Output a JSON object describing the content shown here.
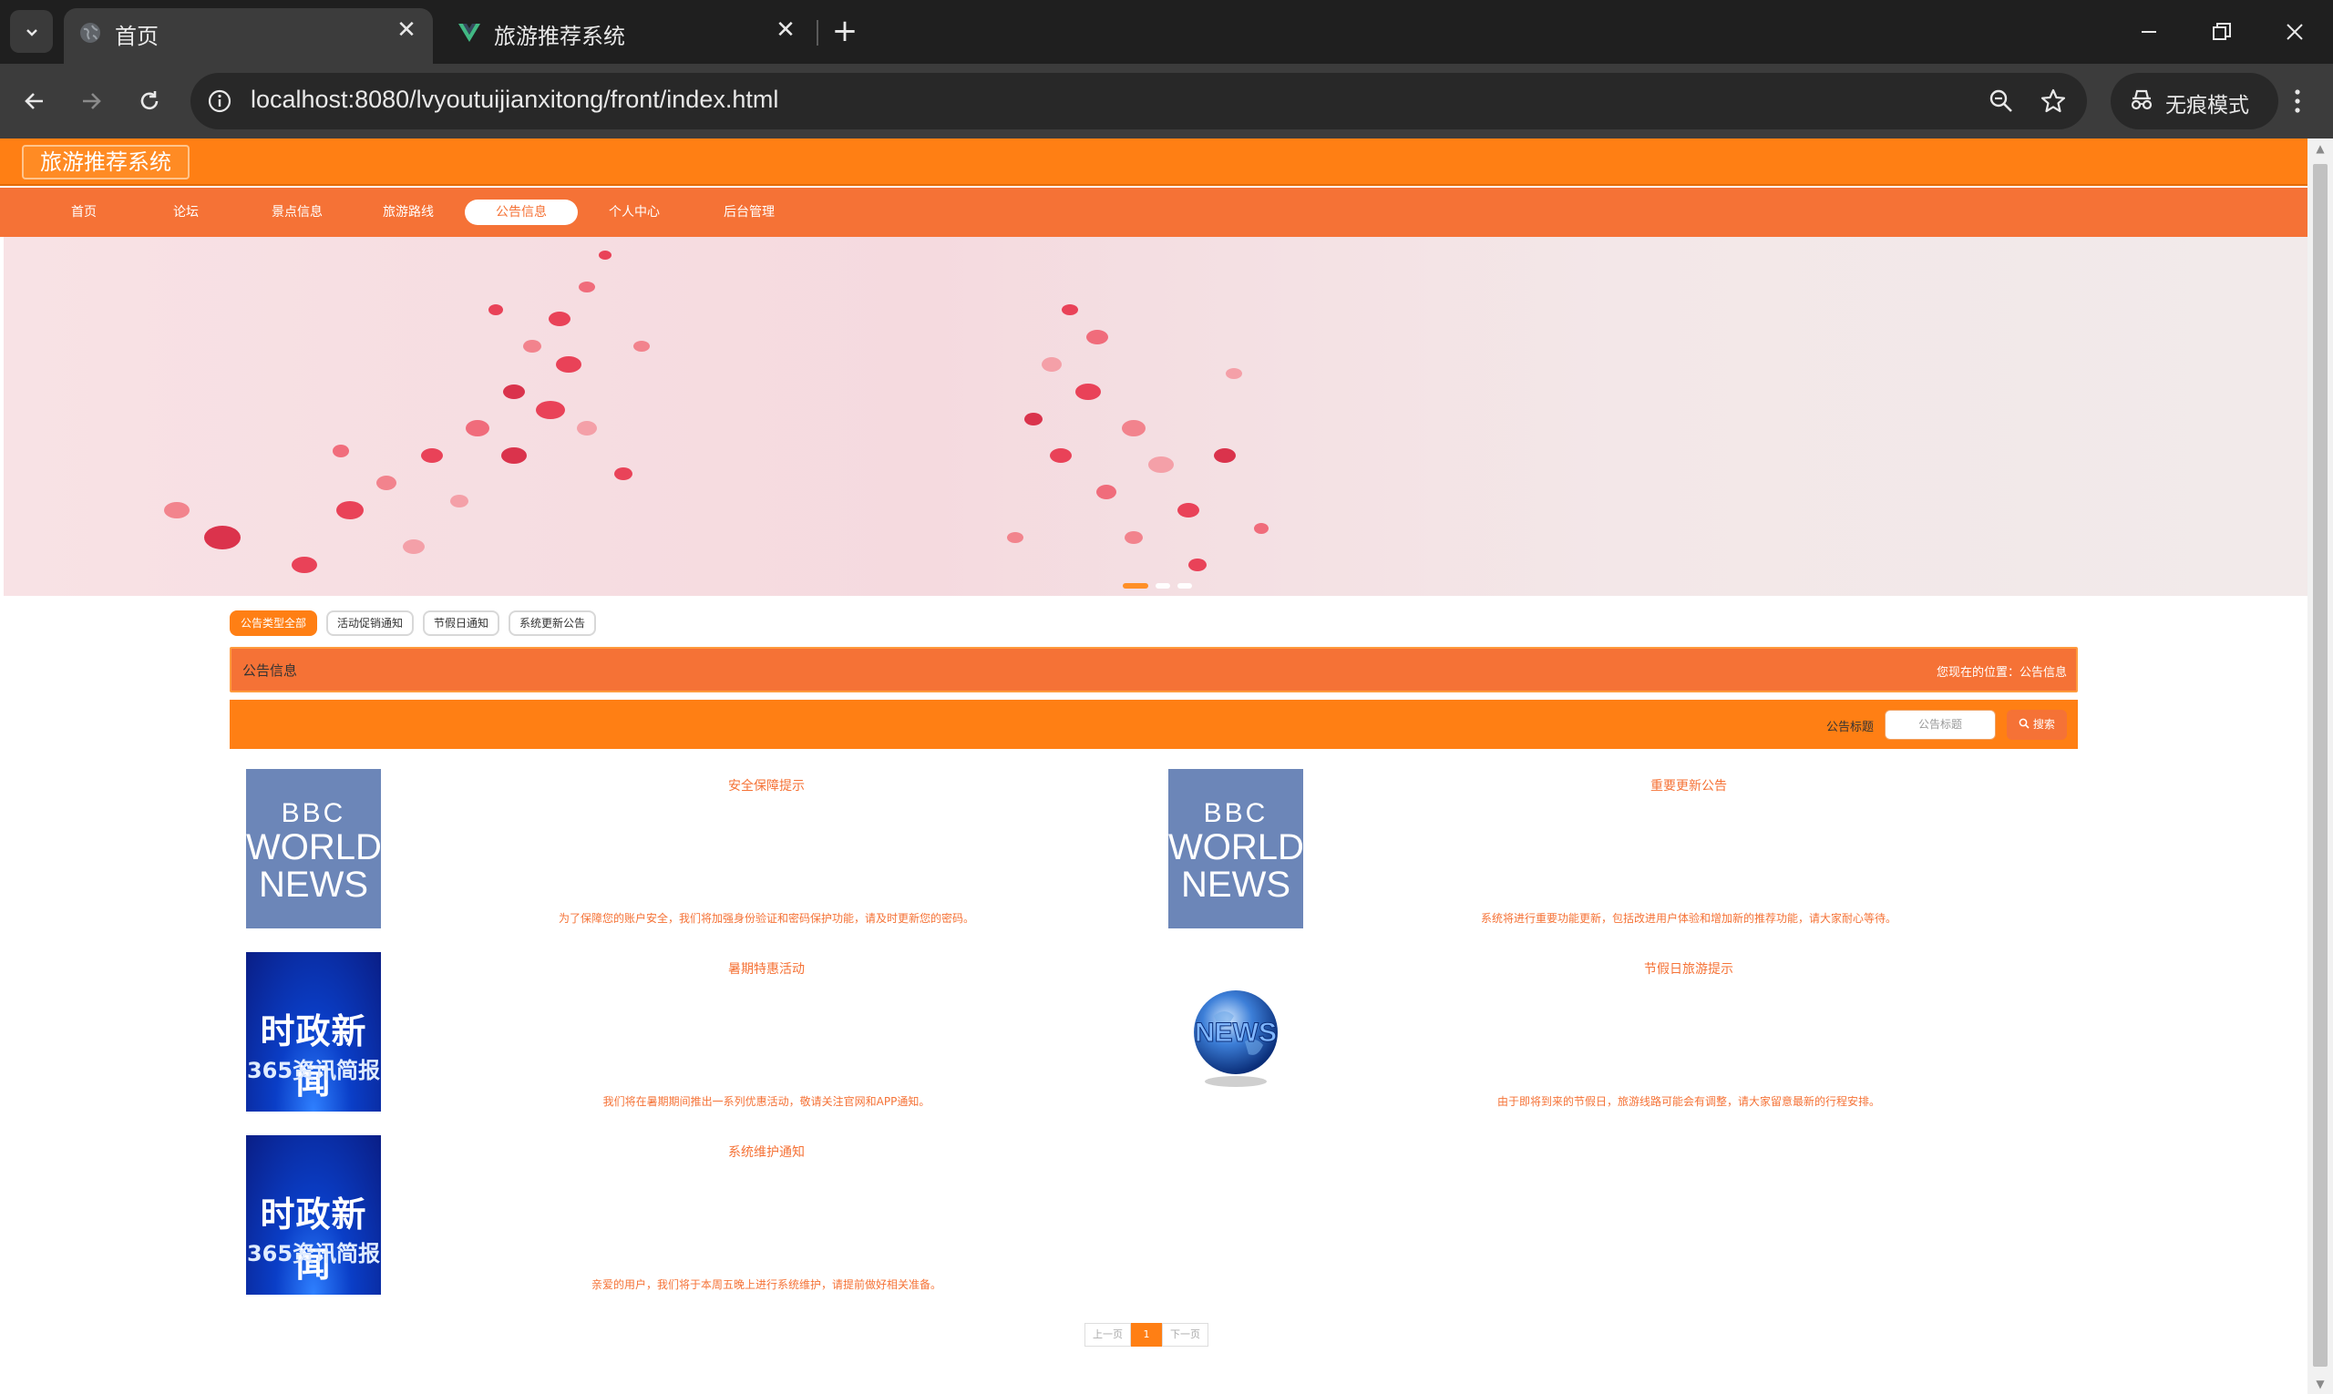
{
  "browser": {
    "tabs": [
      {
        "title": "首页",
        "active": true
      },
      {
        "title": "旅游推荐系统",
        "active": false
      }
    ],
    "url": "localhost:8080/lvyoutuijianxitong/front/index.html",
    "incognito_label": "无痕模式"
  },
  "site": {
    "logo": "旅游推荐系统",
    "nav": [
      {
        "label": "首页",
        "active": false
      },
      {
        "label": "论坛",
        "active": false
      },
      {
        "label": "景点信息",
        "active": false
      },
      {
        "label": "旅游路线",
        "active": false
      },
      {
        "label": "公告信息",
        "active": true
      },
      {
        "label": "个人中心",
        "active": false
      },
      {
        "label": "后台管理",
        "active": false
      }
    ]
  },
  "filters": [
    {
      "label": "公告类型全部",
      "active": true
    },
    {
      "label": "活动促销通知",
      "active": false
    },
    {
      "label": "节假日通知",
      "active": false
    },
    {
      "label": "系统更新公告",
      "active": false
    }
  ],
  "section": {
    "title": "公告信息",
    "location": "您现在的位置：公告信息"
  },
  "search": {
    "label": "公告标题",
    "placeholder": "公告标题",
    "button": "搜索"
  },
  "notices": [
    {
      "title": "安全保障提示",
      "desc": "为了保障您的账户安全，我们将加强身份验证和密码保护功能，请及时更新您的密码。",
      "thumb": "bbc-world-news"
    },
    {
      "title": "重要更新公告",
      "desc": "系统将进行重要功能更新，包括改进用户体验和增加新的推荐功能，请大家耐心等待。",
      "thumb": "bbc-world-news"
    },
    {
      "title": "暑期特惠活动",
      "desc": "我们将在暑期期间推出一系列优惠活动，敬请关注官网和APP通知。",
      "thumb": "shizheng-news"
    },
    {
      "title": "节假日旅游提示",
      "desc": "由于即将到来的节假日，旅游线路可能会有调整，请大家留意最新的行程安排。",
      "thumb": "news-globe"
    },
    {
      "title": "系统维护通知",
      "desc": "亲爱的用户，我们将于本周五晚上进行系统维护，请提前做好相关准备。",
      "thumb": "shizheng-news"
    }
  ],
  "thumb_text": {
    "bbc": [
      "BBC",
      "WORLD",
      "NEWS"
    ],
    "shizheng": [
      "时政新闻",
      "365资讯简报"
    ],
    "globe": "NEWS"
  },
  "pager": {
    "prev": "上一页",
    "current": "1",
    "next": "下一页"
  },
  "colors": {
    "header": "#ff7f14",
    "nav": "#f57236",
    "accent": "#ff7f14"
  }
}
